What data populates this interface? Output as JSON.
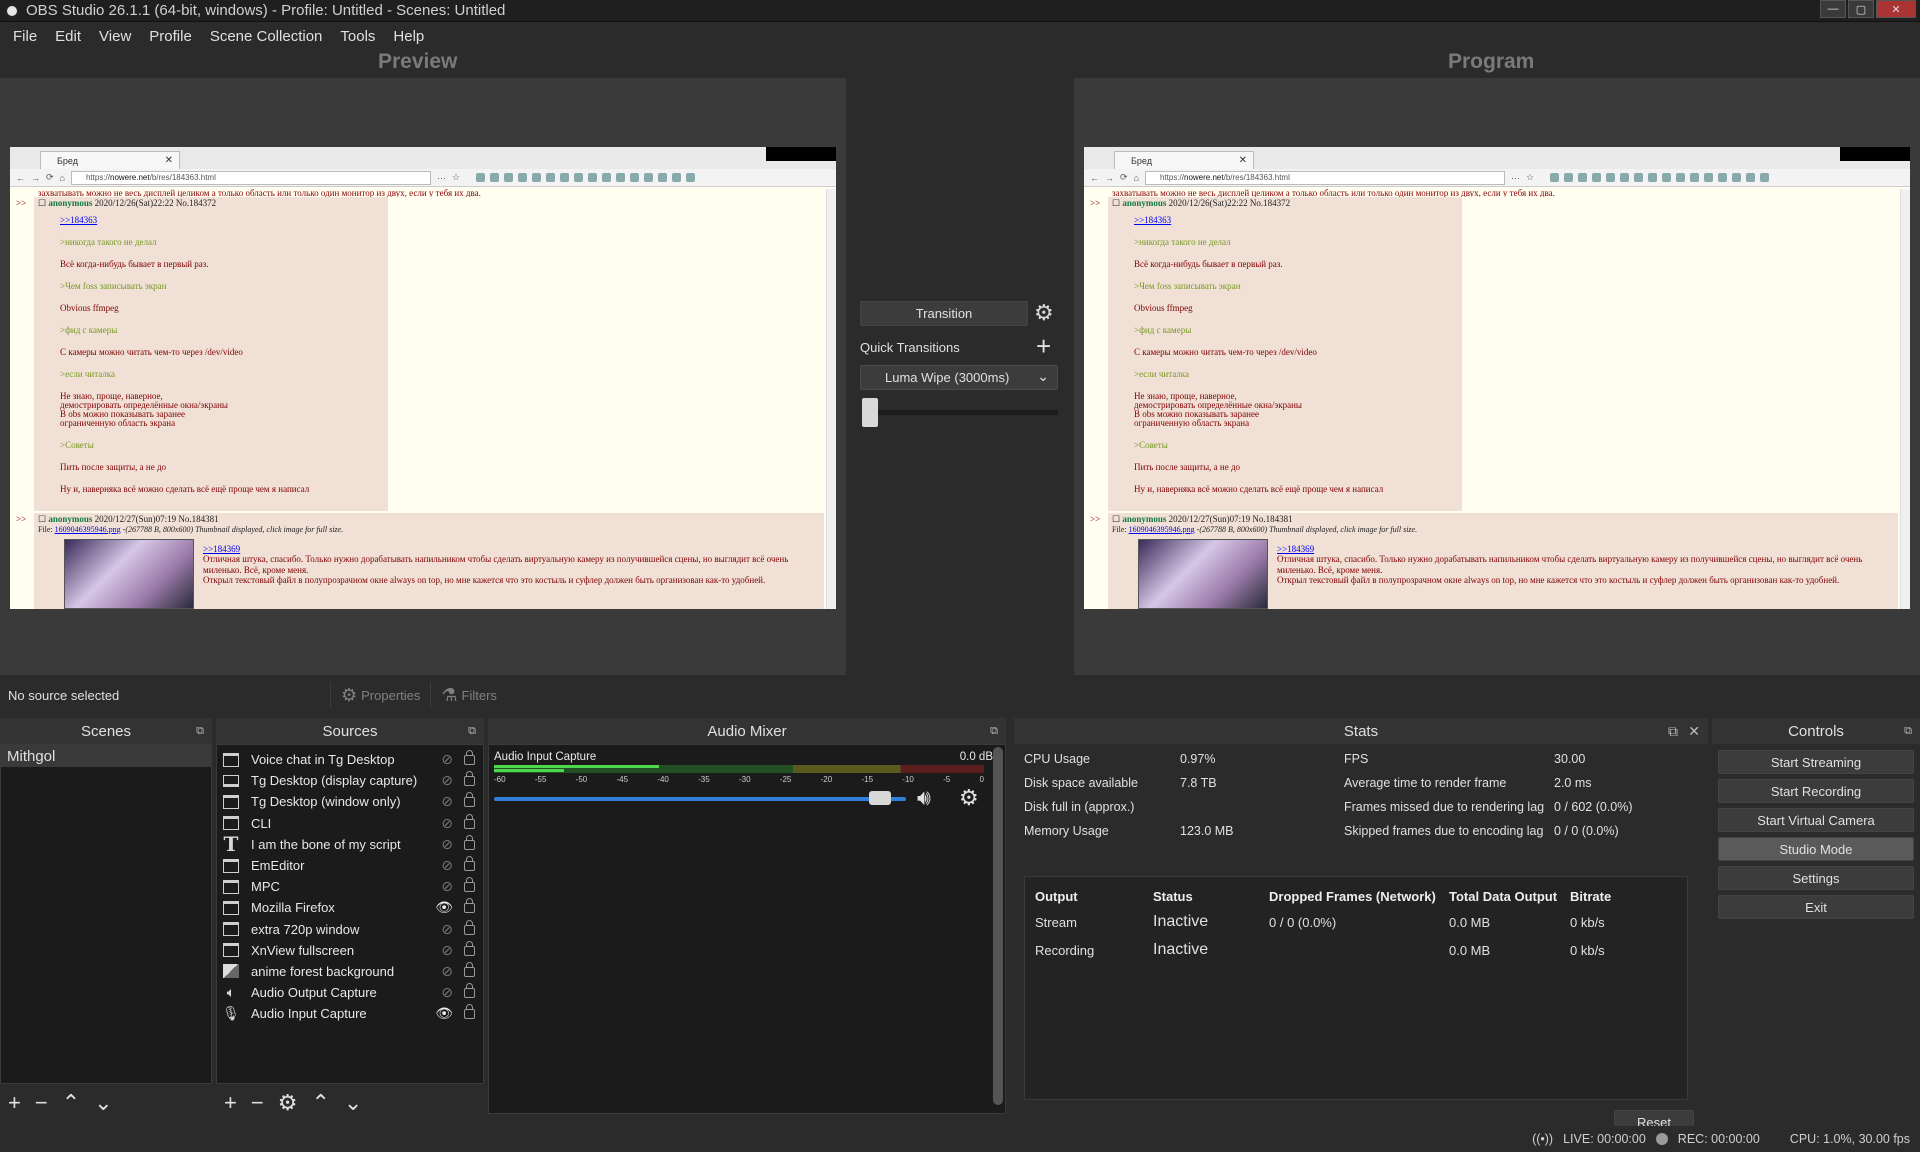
{
  "window": {
    "title": "OBS Studio 26.1.1 (64-bit, windows) - Profile: Untitled - Scenes: Untitled"
  },
  "menu": [
    "File",
    "Edit",
    "View",
    "Profile",
    "Scene Collection",
    "Tools",
    "Help"
  ],
  "preview_label": "Preview",
  "program_label": "Program",
  "browser": {
    "tab_title": "Бред",
    "url_prefix": "https://",
    "url_domain": "nowere.net",
    "url_path": "/b/res/184363.html"
  },
  "thread": {
    "top_line": "захватывать можно не весь дисплей целиком а только область или только один монитор из двух, если у тебя их два.",
    "post1_name": "anonymous",
    "post1_meta": "2020/12/26(Sat)22:22 No.184372",
    "post1_lines": [
      {
        "text": ">>184363",
        "type": "lnk"
      },
      {
        "text": ">никогда такого не делал",
        "type": "q"
      },
      {
        "text": "Всё когда-нибудь бывает в первый раз.",
        "type": "t"
      },
      {
        "text": ">Чем foss записывать экран",
        "type": "q"
      },
      {
        "text": "Obvious ffmpeg",
        "type": "t"
      },
      {
        "text": ">фид с камеры",
        "type": "q"
      },
      {
        "text": "С камеры можно читать чем-то через /dev/video",
        "type": "t"
      },
      {
        "text": ">если читалка",
        "type": "q"
      },
      {
        "text": "Не знаю, проще, наверное,\nдемострировать определённые окна/экраны\nВ obs можно показывать заранее\nограниченную область экрана",
        "type": "t"
      },
      {
        "text": ">Советы",
        "type": "q"
      },
      {
        "text": "Пить после защиты, а не до",
        "type": "t"
      },
      {
        "text": "Ну и, наверняка всё можно сделать всё ещё проще чем я написал",
        "type": "t"
      }
    ],
    "post2_name": "anonymous",
    "post2_meta": "2020/12/27(Sun)07:19 No.184381",
    "post2_file_label": "File:",
    "post2_file_name": "1609046395946.png",
    "post2_file_info": "-(267788 B, 800x600) Thumbnail displayed, click image for full size.",
    "post2_link": ">>184369",
    "post2_body1": "Отличная штука, спасибо. Только нужно дорабатывать напильником чтобы сделать виртуальную камеру из получившейся сцены, но выглядит всё очень миленько. Всё, кроме меня.",
    "post2_body2": "Открыл текстовый файл в полупрозрачном окне always on top, но мне кажется что это костыль и суфлер должен быть организован как-то удобней."
  },
  "transition": {
    "button_label": "Transition",
    "quick_label": "Quick Transitions",
    "selected": "Luma Wipe (3000ms)",
    "tbar_fraction": 0.0
  },
  "context": {
    "no_source": "No source selected",
    "properties": "Properties",
    "filters": "Filters"
  },
  "scenes": {
    "title": "Scenes",
    "items": [
      "Mithgol"
    ]
  },
  "sources": {
    "title": "Sources",
    "items": [
      {
        "name": "Voice chat in Tg Desktop",
        "icon": "window-icon",
        "visible": false
      },
      {
        "name": "Tg Desktop (display capture)",
        "icon": "monitor-icon",
        "visible": false
      },
      {
        "name": "Tg Desktop (window only)",
        "icon": "window-icon",
        "visible": false
      },
      {
        "name": "CLI",
        "icon": "window-icon",
        "visible": false
      },
      {
        "name": "I am the bone of my script",
        "icon": "text-icon",
        "visible": false
      },
      {
        "name": "EmEditor",
        "icon": "window-icon",
        "visible": false
      },
      {
        "name": "MPC",
        "icon": "window-icon",
        "visible": false
      },
      {
        "name": "Mozilla Firefox",
        "icon": "window-icon",
        "visible": true
      },
      {
        "name": "extra 720p window",
        "icon": "window-icon",
        "visible": false
      },
      {
        "name": "XnView fullscreen",
        "icon": "window-icon",
        "visible": false
      },
      {
        "name": "anime forest background",
        "icon": "image-icon",
        "visible": false
      },
      {
        "name": "Audio Output Capture",
        "icon": "speaker-icon",
        "visible": false
      },
      {
        "name": "Audio Input Capture",
        "icon": "microphone-icon",
        "visible": true
      }
    ]
  },
  "mixer": {
    "title": "Audio Mixer",
    "channel_name": "Audio Input Capture",
    "channel_db": "0.0 dB",
    "ticks": [
      "-60",
      "-55",
      "-50",
      "-45",
      "-40",
      "-35",
      "-30",
      "-25",
      "-20",
      "-15",
      "-10",
      "-5",
      "0"
    ],
    "volume_fraction": 0.96
  },
  "stats": {
    "title": "Stats",
    "left": [
      {
        "label": "CPU Usage",
        "value": "0.97%"
      },
      {
        "label": "Disk space available",
        "value": "7.8 TB"
      },
      {
        "label": "Disk full in (approx.)",
        "value": ""
      },
      {
        "label": "Memory Usage",
        "value": "123.0 MB"
      }
    ],
    "right": [
      {
        "label": "FPS",
        "value": "30.00"
      },
      {
        "label": "Average time to render frame",
        "value": "2.0 ms"
      },
      {
        "label": "Frames missed due to rendering lag",
        "value": "0 / 602 (0.0%)"
      },
      {
        "label": "Skipped frames due to encoding lag",
        "value": "0 / 0 (0.0%)"
      }
    ],
    "table_headers": [
      "Output",
      "Status",
      "Dropped Frames (Network)",
      "Total Data Output",
      "Bitrate"
    ],
    "table_rows": [
      [
        "Stream",
        "Inactive",
        "0 / 0 (0.0%)",
        "0.0 MB",
        "0 kb/s"
      ],
      [
        "Recording",
        "Inactive",
        "",
        "0.0 MB",
        "0 kb/s"
      ]
    ],
    "reset_label": "Reset"
  },
  "controls": {
    "title": "Controls",
    "buttons": [
      "Start Streaming",
      "Start Recording",
      "Start Virtual Camera",
      "Studio Mode",
      "Settings",
      "Exit"
    ],
    "active_index": 3
  },
  "status": {
    "live": "LIVE: 00:00:00",
    "rec": "REC: 00:00:00",
    "cpu": "CPU: 1.0%, 30.00 fps"
  },
  "colors": {
    "bg": "#2b2b2b",
    "dock_body": "#1b1b1b",
    "volume_accent": "#2f7fd8",
    "meter_green": "#4ed64e"
  }
}
